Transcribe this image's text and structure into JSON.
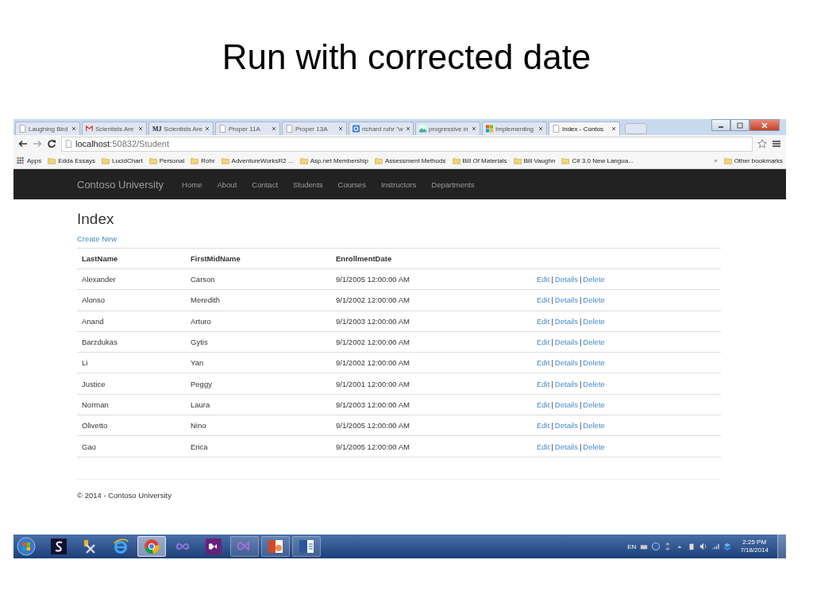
{
  "slide": {
    "title": "Run with corrected date"
  },
  "browser": {
    "tabs": [
      {
        "title": "Laughing Bird",
        "kind": "page",
        "selected": false
      },
      {
        "title": "Scientists Are",
        "kind": "mail",
        "selected": false
      },
      {
        "title": "Scientists Are",
        "kind": "monogram",
        "monogram": "MJ",
        "selected": false
      },
      {
        "title": "Proper 11A",
        "kind": "page",
        "selected": false
      },
      {
        "title": "Proper 13A",
        "kind": "page",
        "selected": false
      },
      {
        "title": "richard rohr \"w",
        "kind": "search",
        "selected": false
      },
      {
        "title": "progressive in",
        "kind": "image",
        "selected": false
      },
      {
        "title": "Implementing",
        "kind": "tiles",
        "selected": false
      },
      {
        "title": "Index - Contos",
        "kind": "page",
        "selected": true
      }
    ],
    "address": {
      "host": "localhost",
      "path": ":50832/Student"
    },
    "bookmarks": [
      {
        "label": "Apps",
        "kind": "apps"
      },
      {
        "label": "Edda Essays",
        "kind": "folder"
      },
      {
        "label": "LucidChart",
        "kind": "folder"
      },
      {
        "label": "Personal",
        "kind": "folder"
      },
      {
        "label": "Rohr",
        "kind": "folder"
      },
      {
        "label": "AdventureWorksR2 ...",
        "kind": "folder"
      },
      {
        "label": "Asp.net Membership",
        "kind": "folder"
      },
      {
        "label": "Assessment Methods",
        "kind": "folder"
      },
      {
        "label": "Bill Of Materials",
        "kind": "folder"
      },
      {
        "label": "Bill Vaughn",
        "kind": "folder"
      },
      {
        "label": "C# 3.0 New Langua...",
        "kind": "folder"
      }
    ],
    "overflow": "»",
    "other_bookmarks": "Other bookmarks"
  },
  "site": {
    "brand": "Contoso University",
    "nav": [
      "Home",
      "About",
      "Contact",
      "Students",
      "Courses",
      "Instructors",
      "Departments"
    ],
    "heading": "Index",
    "create_link": "Create New",
    "columns": [
      "LastName",
      "FirstMidName",
      "EnrollmentDate"
    ],
    "rows": [
      {
        "last": "Alexander",
        "first": "Carson",
        "date": "9/1/2005 12:00:00 AM",
        "actions": [
          {
            "label": "Edit",
            "kind": "link"
          },
          {
            "label": "|",
            "kind": "separator"
          },
          {
            "label": "Details",
            "kind": "link"
          },
          {
            "label": "|",
            "kind": "separator"
          },
          {
            "label": "Delete",
            "kind": "link"
          }
        ]
      },
      {
        "last": "Alonso",
        "first": "Meredith",
        "date": "9/1/2002 12:00:00 AM",
        "actions": [
          {
            "label": "Edit",
            "kind": "link"
          },
          {
            "label": "|",
            "kind": "separator"
          },
          {
            "label": "Details",
            "kind": "link"
          },
          {
            "label": "|",
            "kind": "separator"
          },
          {
            "label": "Delete",
            "kind": "link"
          }
        ]
      },
      {
        "last": "Anand",
        "first": "Arturo",
        "date": "9/1/2003 12:00:00 AM",
        "actions": [
          {
            "label": "Edit",
            "kind": "link"
          },
          {
            "label": "|",
            "kind": "separator"
          },
          {
            "label": "Details",
            "kind": "link"
          },
          {
            "label": "|",
            "kind": "separator"
          },
          {
            "label": "Delete",
            "kind": "link"
          }
        ]
      },
      {
        "last": "Barzdukas",
        "first": "Gytis",
        "date": "9/1/2002 12:00:00 AM",
        "actions": [
          {
            "label": "Edit",
            "kind": "link"
          },
          {
            "label": "|",
            "kind": "separator"
          },
          {
            "label": "Details",
            "kind": "link"
          },
          {
            "label": "|",
            "kind": "separator"
          },
          {
            "label": "Delete",
            "kind": "link"
          }
        ]
      },
      {
        "last": "Li",
        "first": "Yan",
        "date": "9/1/2002 12:00:00 AM",
        "actions": [
          {
            "label": "Edit",
            "kind": "link"
          },
          {
            "label": "|",
            "kind": "separator"
          },
          {
            "label": "Details",
            "kind": "link"
          },
          {
            "label": "|",
            "kind": "separator"
          },
          {
            "label": "Delete",
            "kind": "link"
          }
        ]
      },
      {
        "last": "Justice",
        "first": "Peggy",
        "date": "9/1/2001 12:00:00 AM",
        "actions": [
          {
            "label": "Edit",
            "kind": "link"
          },
          {
            "label": "|",
            "kind": "separator"
          },
          {
            "label": "Details",
            "kind": "link"
          },
          {
            "label": "|",
            "kind": "separator"
          },
          {
            "label": "Delete",
            "kind": "link"
          }
        ]
      },
      {
        "last": "Norman",
        "first": "Laura",
        "date": "9/1/2003 12:00:00 AM",
        "actions": [
          {
            "label": "Edit",
            "kind": "link"
          },
          {
            "label": "|",
            "kind": "separator"
          },
          {
            "label": "Details",
            "kind": "link"
          },
          {
            "label": "|",
            "kind": "separator"
          },
          {
            "label": "Delete",
            "kind": "link"
          }
        ]
      },
      {
        "last": "Olivetto",
        "first": "Nino",
        "date": "9/1/2005 12:00:00 AM",
        "actions": [
          {
            "label": "Edit",
            "kind": "link"
          },
          {
            "label": "|",
            "kind": "separator"
          },
          {
            "label": "Details",
            "kind": "link"
          },
          {
            "label": "|",
            "kind": "separator"
          },
          {
            "label": "Delete",
            "kind": "link"
          }
        ]
      },
      {
        "last": "Gao",
        "first": "Erica",
        "date": "9/1/2005 12:00:00 AM",
        "actions": [
          {
            "label": "Edit",
            "kind": "link"
          },
          {
            "label": "|",
            "kind": "separator"
          },
          {
            "label": "Details",
            "kind": "link"
          },
          {
            "label": "|",
            "kind": "separator"
          },
          {
            "label": "Delete",
            "kind": "link"
          }
        ]
      }
    ],
    "footer": "© 2014 - Contoso University"
  },
  "taskbar": {
    "apps": [
      {
        "kind": "sway",
        "running": false,
        "selected": false
      },
      {
        "kind": "tools",
        "running": false,
        "selected": false
      },
      {
        "kind": "ie",
        "running": false,
        "selected": false
      },
      {
        "kind": "chrome",
        "running": true,
        "selected": true
      },
      {
        "kind": "infinity",
        "running": false,
        "selected": false
      },
      {
        "kind": "vs",
        "running": false,
        "selected": false
      },
      {
        "kind": "vs-outline",
        "running": true,
        "selected": false
      },
      {
        "kind": "powerpoint",
        "running": true,
        "selected": false
      },
      {
        "kind": "word",
        "running": true,
        "selected": false
      }
    ],
    "tray": {
      "language": "EN",
      "time": "2:25 PM",
      "date": "7/18/2014"
    }
  }
}
